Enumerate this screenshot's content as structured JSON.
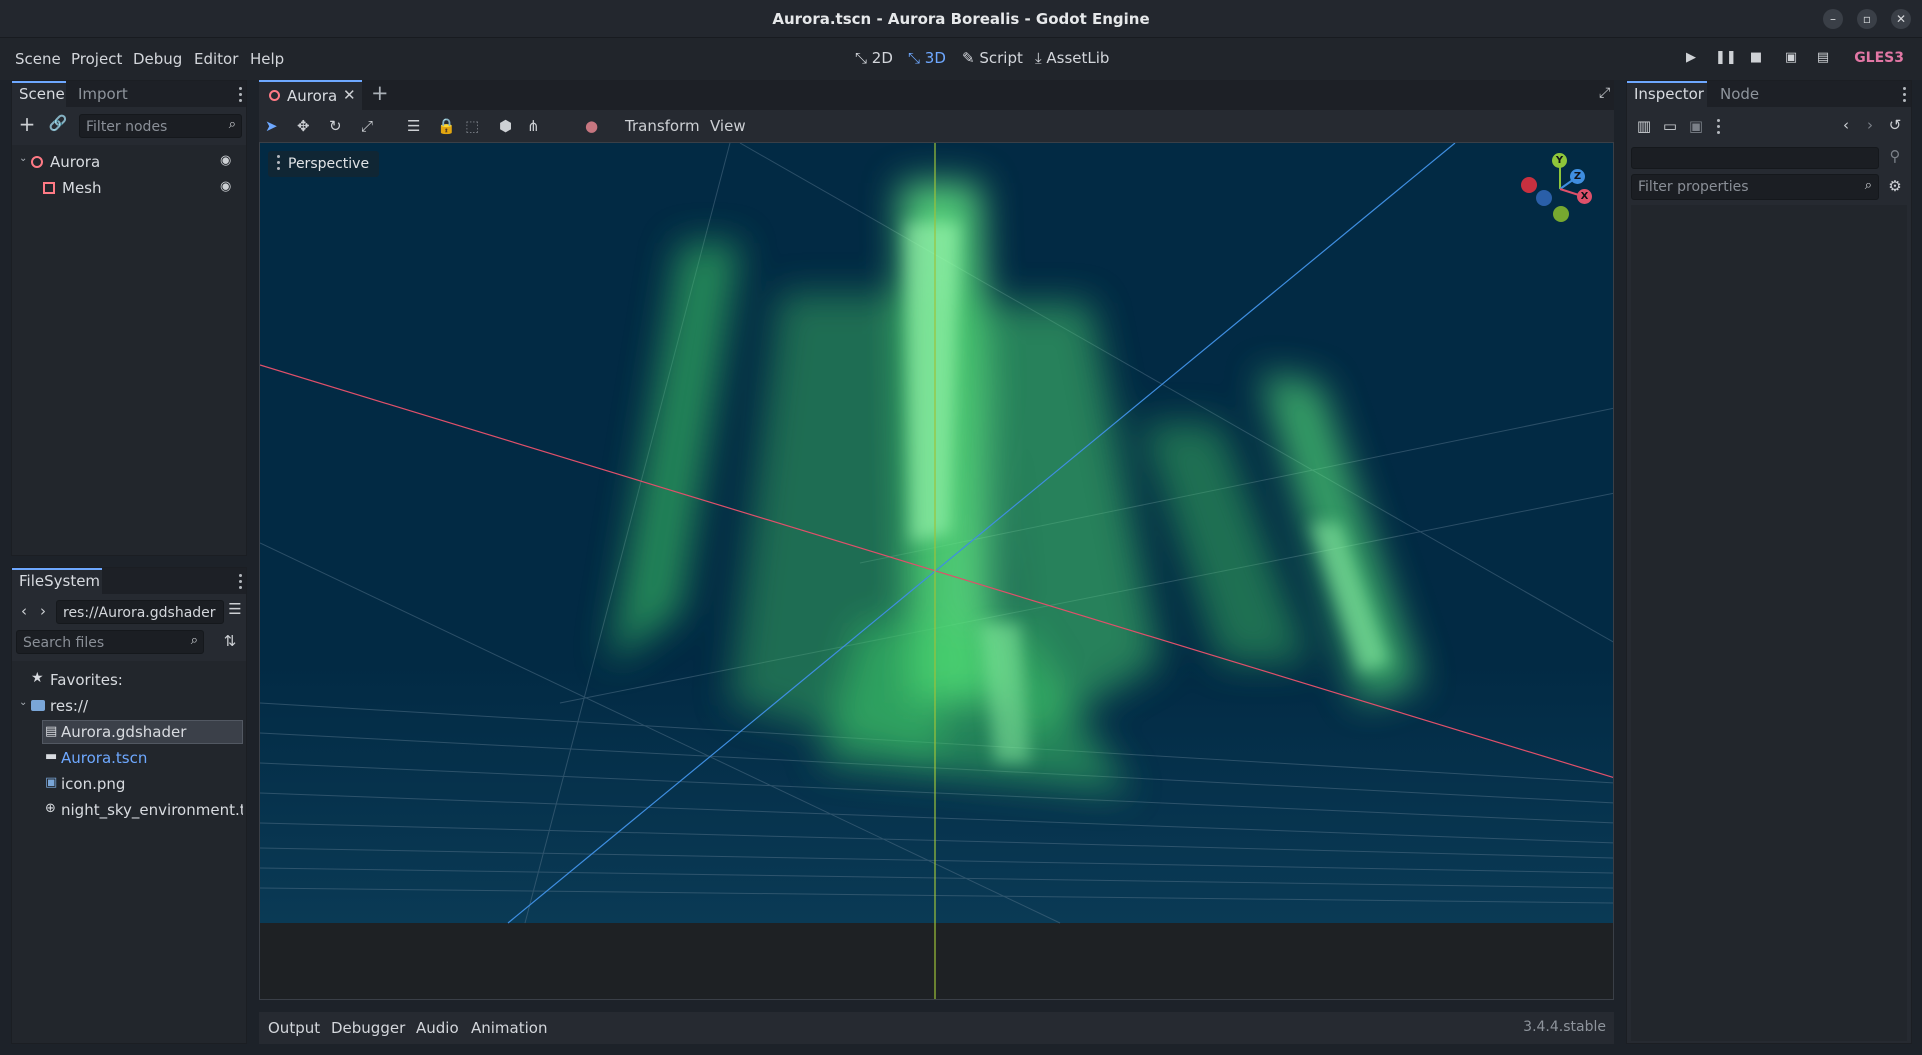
{
  "window": {
    "title": "Aurora.tscn - Aurora Borealis - Godot Engine",
    "controls": [
      "–",
      "▫",
      "✕"
    ]
  },
  "menu": {
    "items": [
      "Scene",
      "Project",
      "Debug",
      "Editor",
      "Help"
    ],
    "workspaces": [
      {
        "label": "2D",
        "icon": "2d-icon",
        "active": false
      },
      {
        "label": "3D",
        "icon": "3d-icon",
        "active": true
      },
      {
        "label": "Script",
        "icon": "script-icon",
        "active": false
      },
      {
        "label": "AssetLib",
        "icon": "assetlib-icon",
        "active": false
      }
    ],
    "renderer": "GLES3",
    "colors": {
      "active": "#6ea8ff",
      "renderer": "#e277a5"
    }
  },
  "scene_dock": {
    "tabs": [
      "Scene",
      "Import"
    ],
    "filter_placeholder": "Filter nodes",
    "nodes": [
      {
        "name": "Aurora",
        "icon": "node3d-icon",
        "expanded": true,
        "visible": true
      },
      {
        "name": "Mesh",
        "icon": "mesh-instance-icon",
        "visible": true
      }
    ]
  },
  "filesystem_dock": {
    "tab": "FileSystem",
    "path": "res://Aurora.gdshader",
    "search_placeholder": "Search files",
    "favorites_label": "Favorites:",
    "root": "res://",
    "files": [
      {
        "name": "Aurora.gdshader",
        "icon": "shader-icon",
        "selected": true
      },
      {
        "name": "Aurora.tscn",
        "icon": "scene-icon",
        "highlight": true
      },
      {
        "name": "icon.png",
        "icon": "image-icon"
      },
      {
        "name": "night_sky_environment.tre",
        "icon": "environment-icon"
      }
    ]
  },
  "editor": {
    "scene_tab": "Aurora",
    "toolbar": {
      "transform": "Transform",
      "view": "View"
    },
    "viewport": {
      "perspective_label": "Perspective",
      "gizmo": {
        "x": "X",
        "y": "Y",
        "z": "Z"
      }
    }
  },
  "inspector": {
    "tabs": [
      "Inspector",
      "Node"
    ],
    "filter_placeholder": "Filter properties"
  },
  "bottom": {
    "tabs": [
      "Output",
      "Debugger",
      "Audio",
      "Animation"
    ],
    "version": "3.4.4.stable"
  }
}
